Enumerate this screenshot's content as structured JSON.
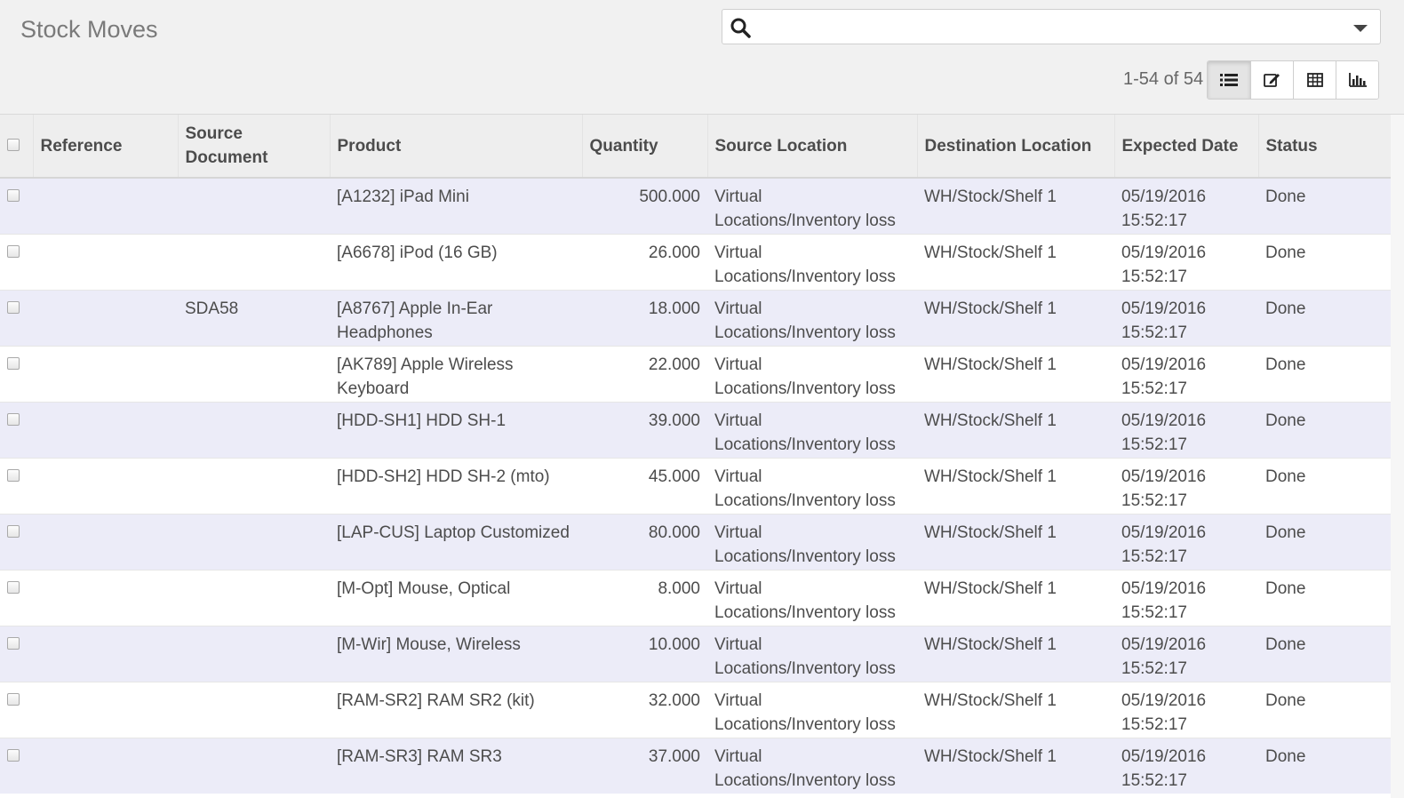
{
  "header": {
    "title": "Stock Moves",
    "search_placeholder": "",
    "pager": "1-54 of 54"
  },
  "views": [
    {
      "name": "list",
      "icon": "list-icon",
      "active": true
    },
    {
      "name": "form",
      "icon": "edit-icon",
      "active": false
    },
    {
      "name": "pivot",
      "icon": "table-icon",
      "active": false
    },
    {
      "name": "graph",
      "icon": "bar-chart-icon",
      "active": false
    }
  ],
  "columns": {
    "reference": "Reference",
    "source_document": "Source Document",
    "product": "Product",
    "quantity": "Quantity",
    "source_location": "Source Location",
    "destination_location": "Destination Location",
    "expected_date": "Expected Date",
    "status": "Status"
  },
  "rows": [
    {
      "reference": "",
      "source_document": "",
      "product": "[A1232] iPad Mini",
      "quantity": "500.000",
      "source_location": "Virtual Locations/Inventory loss",
      "destination_location": "WH/Stock/Shelf 1",
      "expected_date": "05/19/2016 15:52:17",
      "status": "Done"
    },
    {
      "reference": "",
      "source_document": "",
      "product": "[A6678] iPod (16 GB)",
      "quantity": "26.000",
      "source_location": "Virtual Locations/Inventory loss",
      "destination_location": "WH/Stock/Shelf 1",
      "expected_date": "05/19/2016 15:52:17",
      "status": "Done"
    },
    {
      "reference": "",
      "source_document": "SDA58",
      "product": "[A8767] Apple In-Ear Headphones",
      "quantity": "18.000",
      "source_location": "Virtual Locations/Inventory loss",
      "destination_location": "WH/Stock/Shelf 1",
      "expected_date": "05/19/2016 15:52:17",
      "status": "Done"
    },
    {
      "reference": "",
      "source_document": "",
      "product": "[AK789] Apple Wireless Keyboard",
      "quantity": "22.000",
      "source_location": "Virtual Locations/Inventory loss",
      "destination_location": "WH/Stock/Shelf 1",
      "expected_date": "05/19/2016 15:52:17",
      "status": "Done"
    },
    {
      "reference": "",
      "source_document": "",
      "product": "[HDD-SH1] HDD SH-1",
      "quantity": "39.000",
      "source_location": "Virtual Locations/Inventory loss",
      "destination_location": "WH/Stock/Shelf 1",
      "expected_date": "05/19/2016 15:52:17",
      "status": "Done"
    },
    {
      "reference": "",
      "source_document": "",
      "product": "[HDD-SH2] HDD SH-2 (mto)",
      "quantity": "45.000",
      "source_location": "Virtual Locations/Inventory loss",
      "destination_location": "WH/Stock/Shelf 1",
      "expected_date": "05/19/2016 15:52:17",
      "status": "Done"
    },
    {
      "reference": "",
      "source_document": "",
      "product": "[LAP-CUS] Laptop Customized",
      "quantity": "80.000",
      "source_location": "Virtual Locations/Inventory loss",
      "destination_location": "WH/Stock/Shelf 1",
      "expected_date": "05/19/2016 15:52:17",
      "status": "Done"
    },
    {
      "reference": "",
      "source_document": "",
      "product": "[M-Opt] Mouse, Optical",
      "quantity": "8.000",
      "source_location": "Virtual Locations/Inventory loss",
      "destination_location": "WH/Stock/Shelf 1",
      "expected_date": "05/19/2016 15:52:17",
      "status": "Done"
    },
    {
      "reference": "",
      "source_document": "",
      "product": "[M-Wir] Mouse, Wireless",
      "quantity": "10.000",
      "source_location": "Virtual Locations/Inventory loss",
      "destination_location": "WH/Stock/Shelf 1",
      "expected_date": "05/19/2016 15:52:17",
      "status": "Done"
    },
    {
      "reference": "",
      "source_document": "",
      "product": "[RAM-SR2] RAM SR2 (kit)",
      "quantity": "32.000",
      "source_location": "Virtual Locations/Inventory loss",
      "destination_location": "WH/Stock/Shelf 1",
      "expected_date": "05/19/2016 15:52:17",
      "status": "Done"
    },
    {
      "reference": "",
      "source_document": "",
      "product": "[RAM-SR3] RAM SR3",
      "quantity": "37.000",
      "source_location": "Virtual Locations/Inventory loss",
      "destination_location": "WH/Stock/Shelf 1",
      "expected_date": "05/19/2016 15:52:17",
      "status": "Done"
    }
  ]
}
